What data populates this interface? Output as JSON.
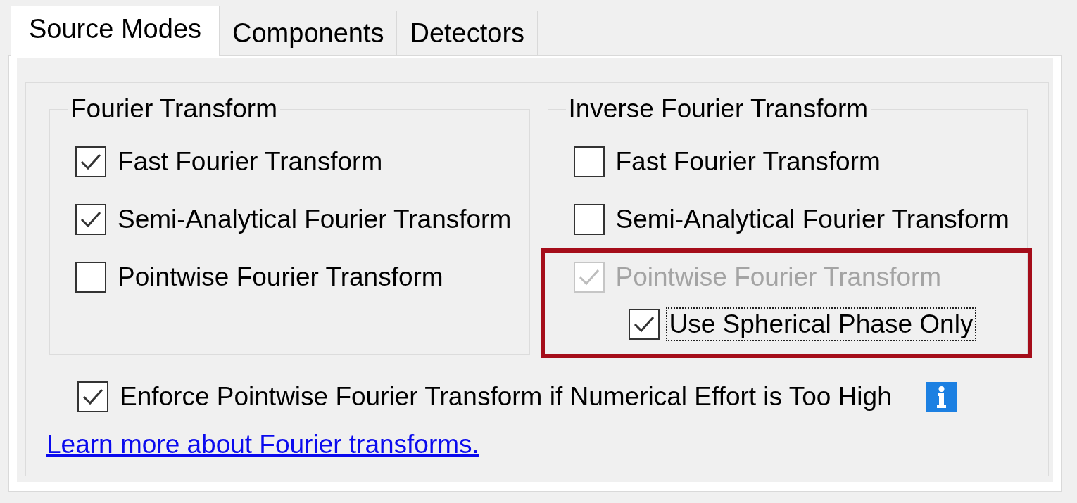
{
  "tabs": [
    {
      "label": "Source Modes",
      "selected": true
    },
    {
      "label": "Components",
      "selected": false
    },
    {
      "label": "Detectors",
      "selected": false
    }
  ],
  "groups": [
    {
      "title": "Fourier Transform",
      "options": [
        {
          "label": "Fast Fourier Transform",
          "checked": true,
          "disabled": false,
          "focused": false,
          "highlighted": false
        },
        {
          "label": "Semi-Analytical Fourier Transform",
          "checked": true,
          "disabled": false,
          "focused": false,
          "highlighted": false
        },
        {
          "label": "Pointwise Fourier Transform",
          "checked": false,
          "disabled": false,
          "focused": false,
          "highlighted": false
        }
      ]
    },
    {
      "title": "Inverse Fourier Transform",
      "options": [
        {
          "label": "Fast Fourier Transform",
          "checked": false,
          "disabled": false,
          "focused": false,
          "highlighted": false
        },
        {
          "label": "Semi-Analytical Fourier Transform",
          "checked": false,
          "disabled": false,
          "focused": false,
          "highlighted": false
        },
        {
          "label": "Pointwise Fourier Transform",
          "checked": true,
          "disabled": true,
          "focused": false,
          "highlighted": true,
          "children": [
            {
              "label": "Use Spherical Phase Only",
              "checked": true,
              "disabled": false,
              "focused": true
            }
          ]
        }
      ]
    }
  ],
  "enforce_option": {
    "label": "Enforce Pointwise Fourier Transform if Numerical Effort is Too High",
    "checked": true
  },
  "link": {
    "label": "Learn more about Fourier transforms."
  }
}
